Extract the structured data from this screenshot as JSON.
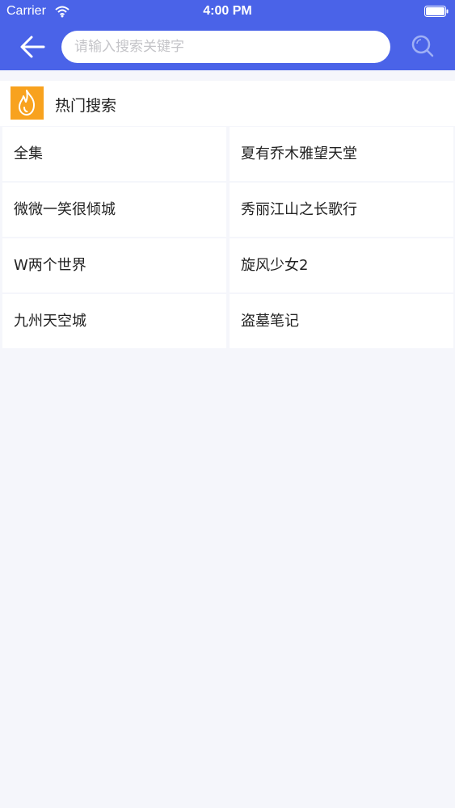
{
  "status_bar": {
    "carrier": "Carrier",
    "time": "4:00 PM"
  },
  "nav": {
    "search_placeholder": "请输入搜索关键字",
    "search_value": ""
  },
  "hot": {
    "title": "热门搜索",
    "items": [
      "全集",
      "夏有乔木雅望天堂",
      "微微一笑很倾城",
      "秀丽江山之长歌行",
      "W两个世界",
      "旋风少女2",
      "九州天空城",
      "盗墓笔记"
    ]
  },
  "colors": {
    "header_bg": "#4a63e8",
    "fire_icon_bg": "#f8a21e",
    "page_bg": "#f5f6fb"
  }
}
